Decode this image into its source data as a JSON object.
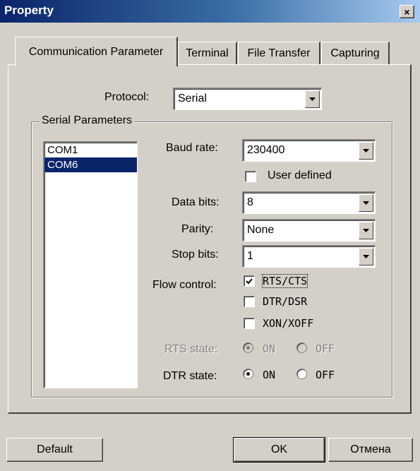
{
  "window": {
    "title": "Property",
    "close_glyph": "×"
  },
  "tabs": [
    {
      "label": "Communication Parameter",
      "active": true
    },
    {
      "label": "Terminal",
      "active": false
    },
    {
      "label": "File Transfer",
      "active": false
    },
    {
      "label": "Capturing",
      "active": false
    }
  ],
  "protocol": {
    "label": "Protocol:",
    "value": "Serial"
  },
  "serial_params": {
    "group_title": "Serial Parameters",
    "ports": [
      {
        "name": "COM1",
        "selected": false
      },
      {
        "name": "COM6",
        "selected": true
      }
    ],
    "baud_rate": {
      "label": "Baud rate:",
      "value": "230400"
    },
    "user_defined": {
      "label": "User defined",
      "checked": false
    },
    "data_bits": {
      "label": "Data bits:",
      "value": "8"
    },
    "parity": {
      "label": "Parity:",
      "value": "None"
    },
    "stop_bits": {
      "label": "Stop bits:",
      "value": "1"
    },
    "flow_control": {
      "label": "Flow control:",
      "options": [
        {
          "label": "RTS/CTS",
          "checked": true
        },
        {
          "label": "DTR/DSR",
          "checked": false
        },
        {
          "label": "XON/XOFF",
          "checked": false
        }
      ]
    },
    "rts_state": {
      "label": "RTS state:",
      "on_label": "ON",
      "off_label": "OFF",
      "value": "ON",
      "enabled": false
    },
    "dtr_state": {
      "label": "DTR state:",
      "on_label": "ON",
      "off_label": "OFF",
      "value": "ON",
      "enabled": true
    }
  },
  "buttons": {
    "default": "Default",
    "ok": "OK",
    "cancel": "Отмена"
  },
  "icons": {
    "dropdown": "chevron-down-icon",
    "check": "check-icon",
    "close": "close-icon"
  }
}
